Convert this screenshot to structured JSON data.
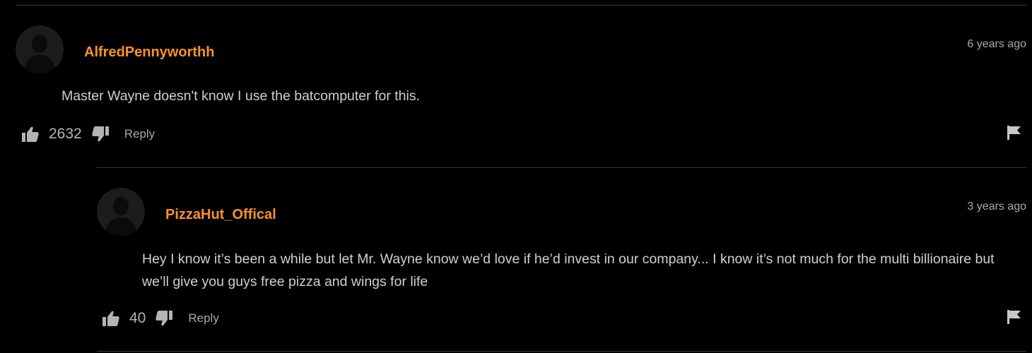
{
  "comments": [
    {
      "username": "AlfredPennyworthh",
      "timestamp": "6 years ago",
      "text": "Master Wayne doesn't know I use the batcomputer for this.",
      "likes": "2632",
      "reply_label": "Reply"
    },
    {
      "username": "PizzaHut_Offical",
      "timestamp": "3 years ago",
      "text": "Hey I know it’s been a while but let Mr. Wayne know we’d love if he’d invest in our company... I know it’s not much for the multi billionaire but we’ll give you guys free pizza and wings for life",
      "likes": "40",
      "reply_label": "Reply"
    }
  ],
  "colors": {
    "background": "#000000",
    "username": "#f7922b",
    "divider": "#3a3a3a"
  },
  "icons": [
    "avatar-placeholder",
    "thumbs-up-icon",
    "thumbs-down-icon",
    "flag-icon"
  ]
}
